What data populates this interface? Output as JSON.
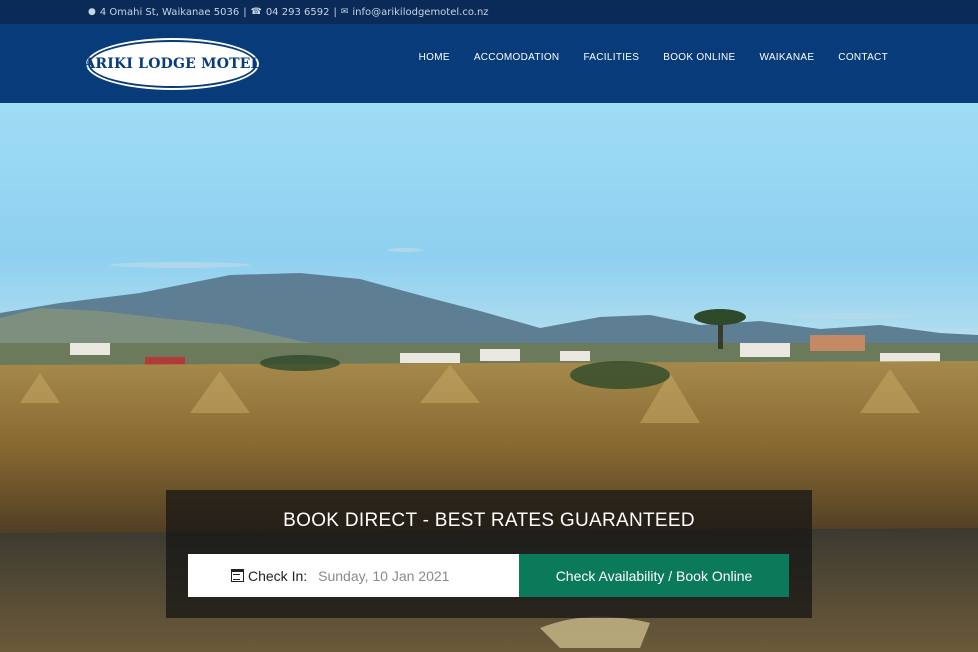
{
  "topbar": {
    "address": "4 Omahi St, Waikanae 5036",
    "phone": "04 293 6592",
    "email": "info@arikilodgemotel.co.nz"
  },
  "logo": {
    "text": "ARIKI LODGE MOTEL"
  },
  "nav": {
    "items": [
      "HOME",
      "ACCOMODATION",
      "FACILITIES",
      "BOOK ONLINE",
      "WAIKANAE",
      "CONTACT"
    ]
  },
  "booking": {
    "title": "BOOK DIRECT - BEST RATES GUARANTEED",
    "checkin_label": "Check In:",
    "checkin_value": "Sunday, 10 Jan 2021",
    "button_label": "Check Availability / Book Online"
  },
  "icons": {
    "address": "map-marker-icon",
    "phone": "phone-icon",
    "email": "envelope-icon",
    "calendar": "calendar-icon"
  },
  "colors": {
    "header_bg": "#073b7a",
    "topbar_bg": "#0a2b57",
    "button_bg": "#0a7a5a"
  }
}
